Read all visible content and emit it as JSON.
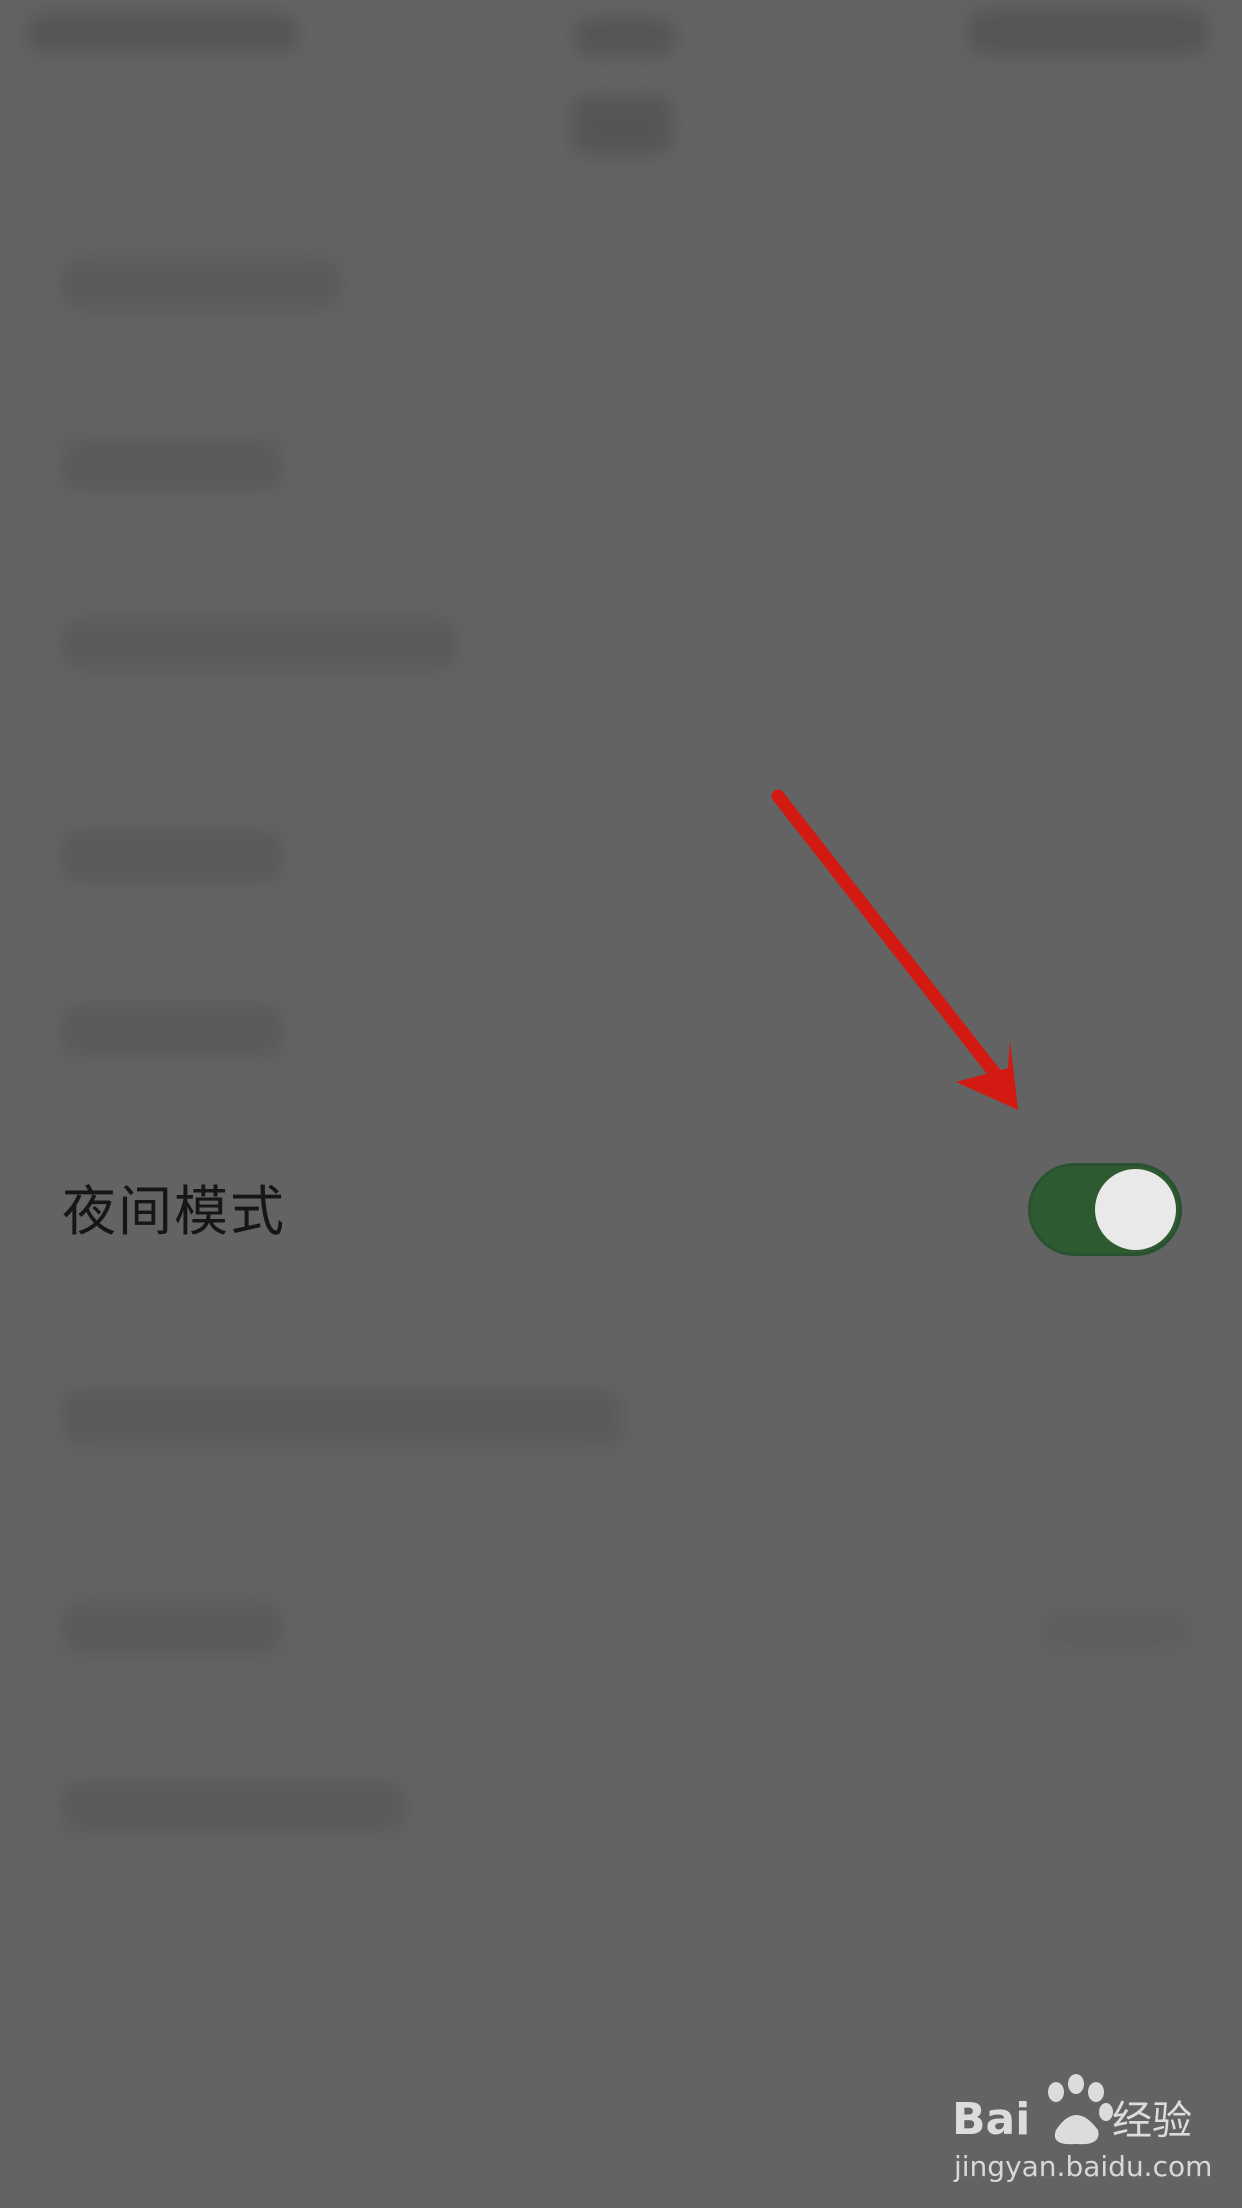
{
  "settings": {
    "night_mode": {
      "label": "夜间模式",
      "enabled": true,
      "toggle_color": "#2e5a32"
    }
  },
  "colors": {
    "overlay_background": "#636363",
    "annotation_arrow": "#d21a12"
  },
  "watermark": {
    "brand": "Bai经验",
    "url": "jingyan.baidu.com"
  }
}
